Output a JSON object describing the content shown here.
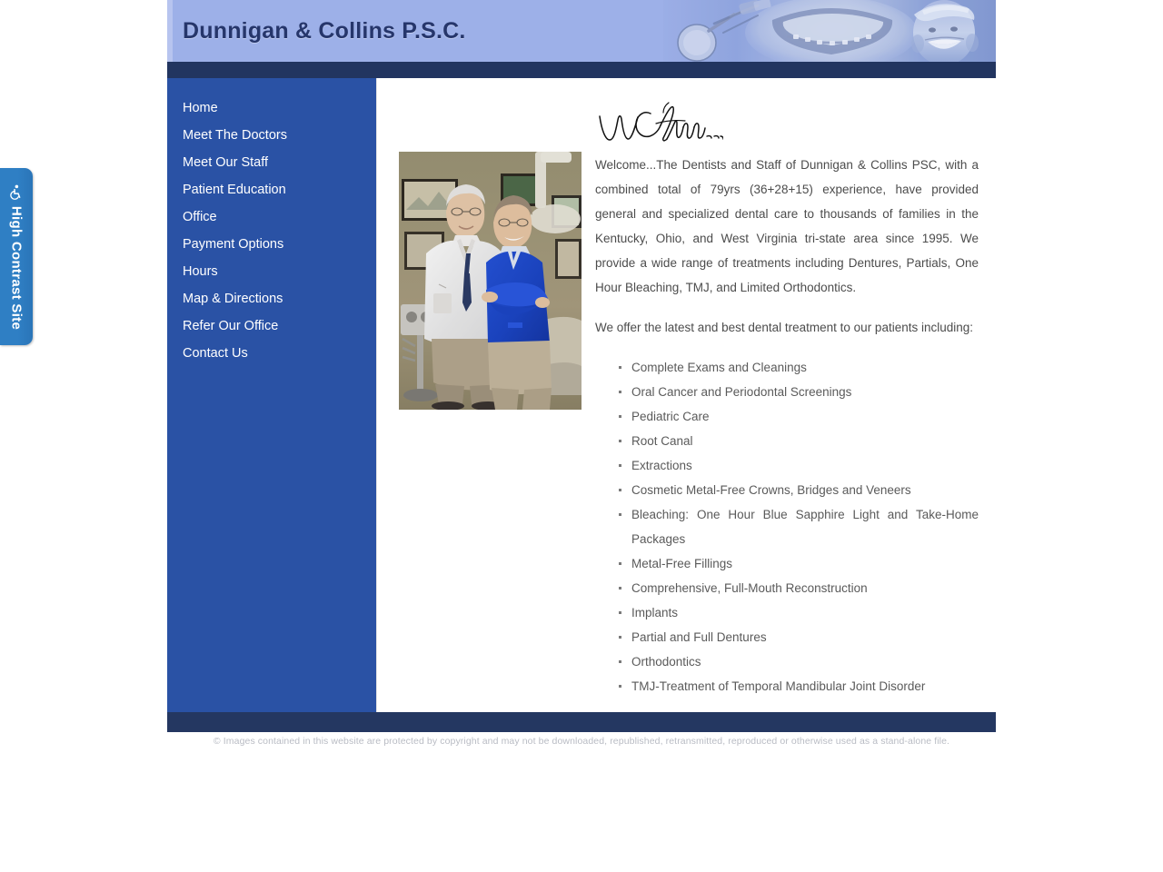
{
  "accessibility_tab": {
    "label": "High Contrast Site",
    "icon": "wheelchair-icon"
  },
  "header": {
    "title": "Dunnigan & Collins P.S.C.",
    "banner_alt": "dental banner with mirror instrument, braces and smiling child"
  },
  "sidebar": {
    "items": [
      {
        "label": "Home"
      },
      {
        "label": "Meet The Doctors"
      },
      {
        "label": "Meet Our Staff"
      },
      {
        "label": "Patient Education"
      },
      {
        "label": "Office"
      },
      {
        "label": "Payment Options"
      },
      {
        "label": "Hours"
      },
      {
        "label": "Map & Directions"
      },
      {
        "label": "Refer Our Office"
      },
      {
        "label": "Contact Us"
      }
    ]
  },
  "main": {
    "welcome_heading": "Welcome...",
    "photo_alt": "Two dentists standing in a dental operatory, one in a white lab coat and one in blue scrubs",
    "paragraphs": [
      "Welcome...The Dentists and Staff of Dunnigan & Collins PSC, with a combined total of 79yrs (36+28+15) experience, have provided general and specialized dental care to thousands of families in the Kentucky, Ohio, and West Virginia tri-state area since 1995. We provide a wide range of treatments including Dentures, Partials, One Hour Bleaching, TMJ, and Limited Orthodontics.",
      "We offer the latest and best dental treatment to our patients including:"
    ],
    "services": [
      "Complete Exams and Cleanings",
      "Oral Cancer and Periodontal Screenings",
      "Pediatric Care",
      "Root Canal",
      "Extractions",
      "Cosmetic Metal-Free Crowns, Bridges and Veneers",
      "Bleaching: One Hour Blue Sapphire Light and Take-Home Packages",
      "Metal-Free Fillings",
      "Comprehensive, Full-Mouth Reconstruction",
      "Implants",
      "Partial and Full Dentures",
      "Orthodontics",
      "TMJ-Treatment of Temporal Mandibular Joint Disorder"
    ]
  },
  "footer": {
    "copyright": "© Images contained in this website are protected by copyright and may not be downloaded, republished, retransmitted, reproduced or otherwise used as a stand-alone file."
  },
  "colors": {
    "header_bg": "#9db0e8",
    "navy_bar": "#223560",
    "sidebar_blue": "#2a52a5",
    "title_navy": "#26366b",
    "accessibility_blue": "#2f7fc4",
    "body_text": "#4c4c4c"
  }
}
